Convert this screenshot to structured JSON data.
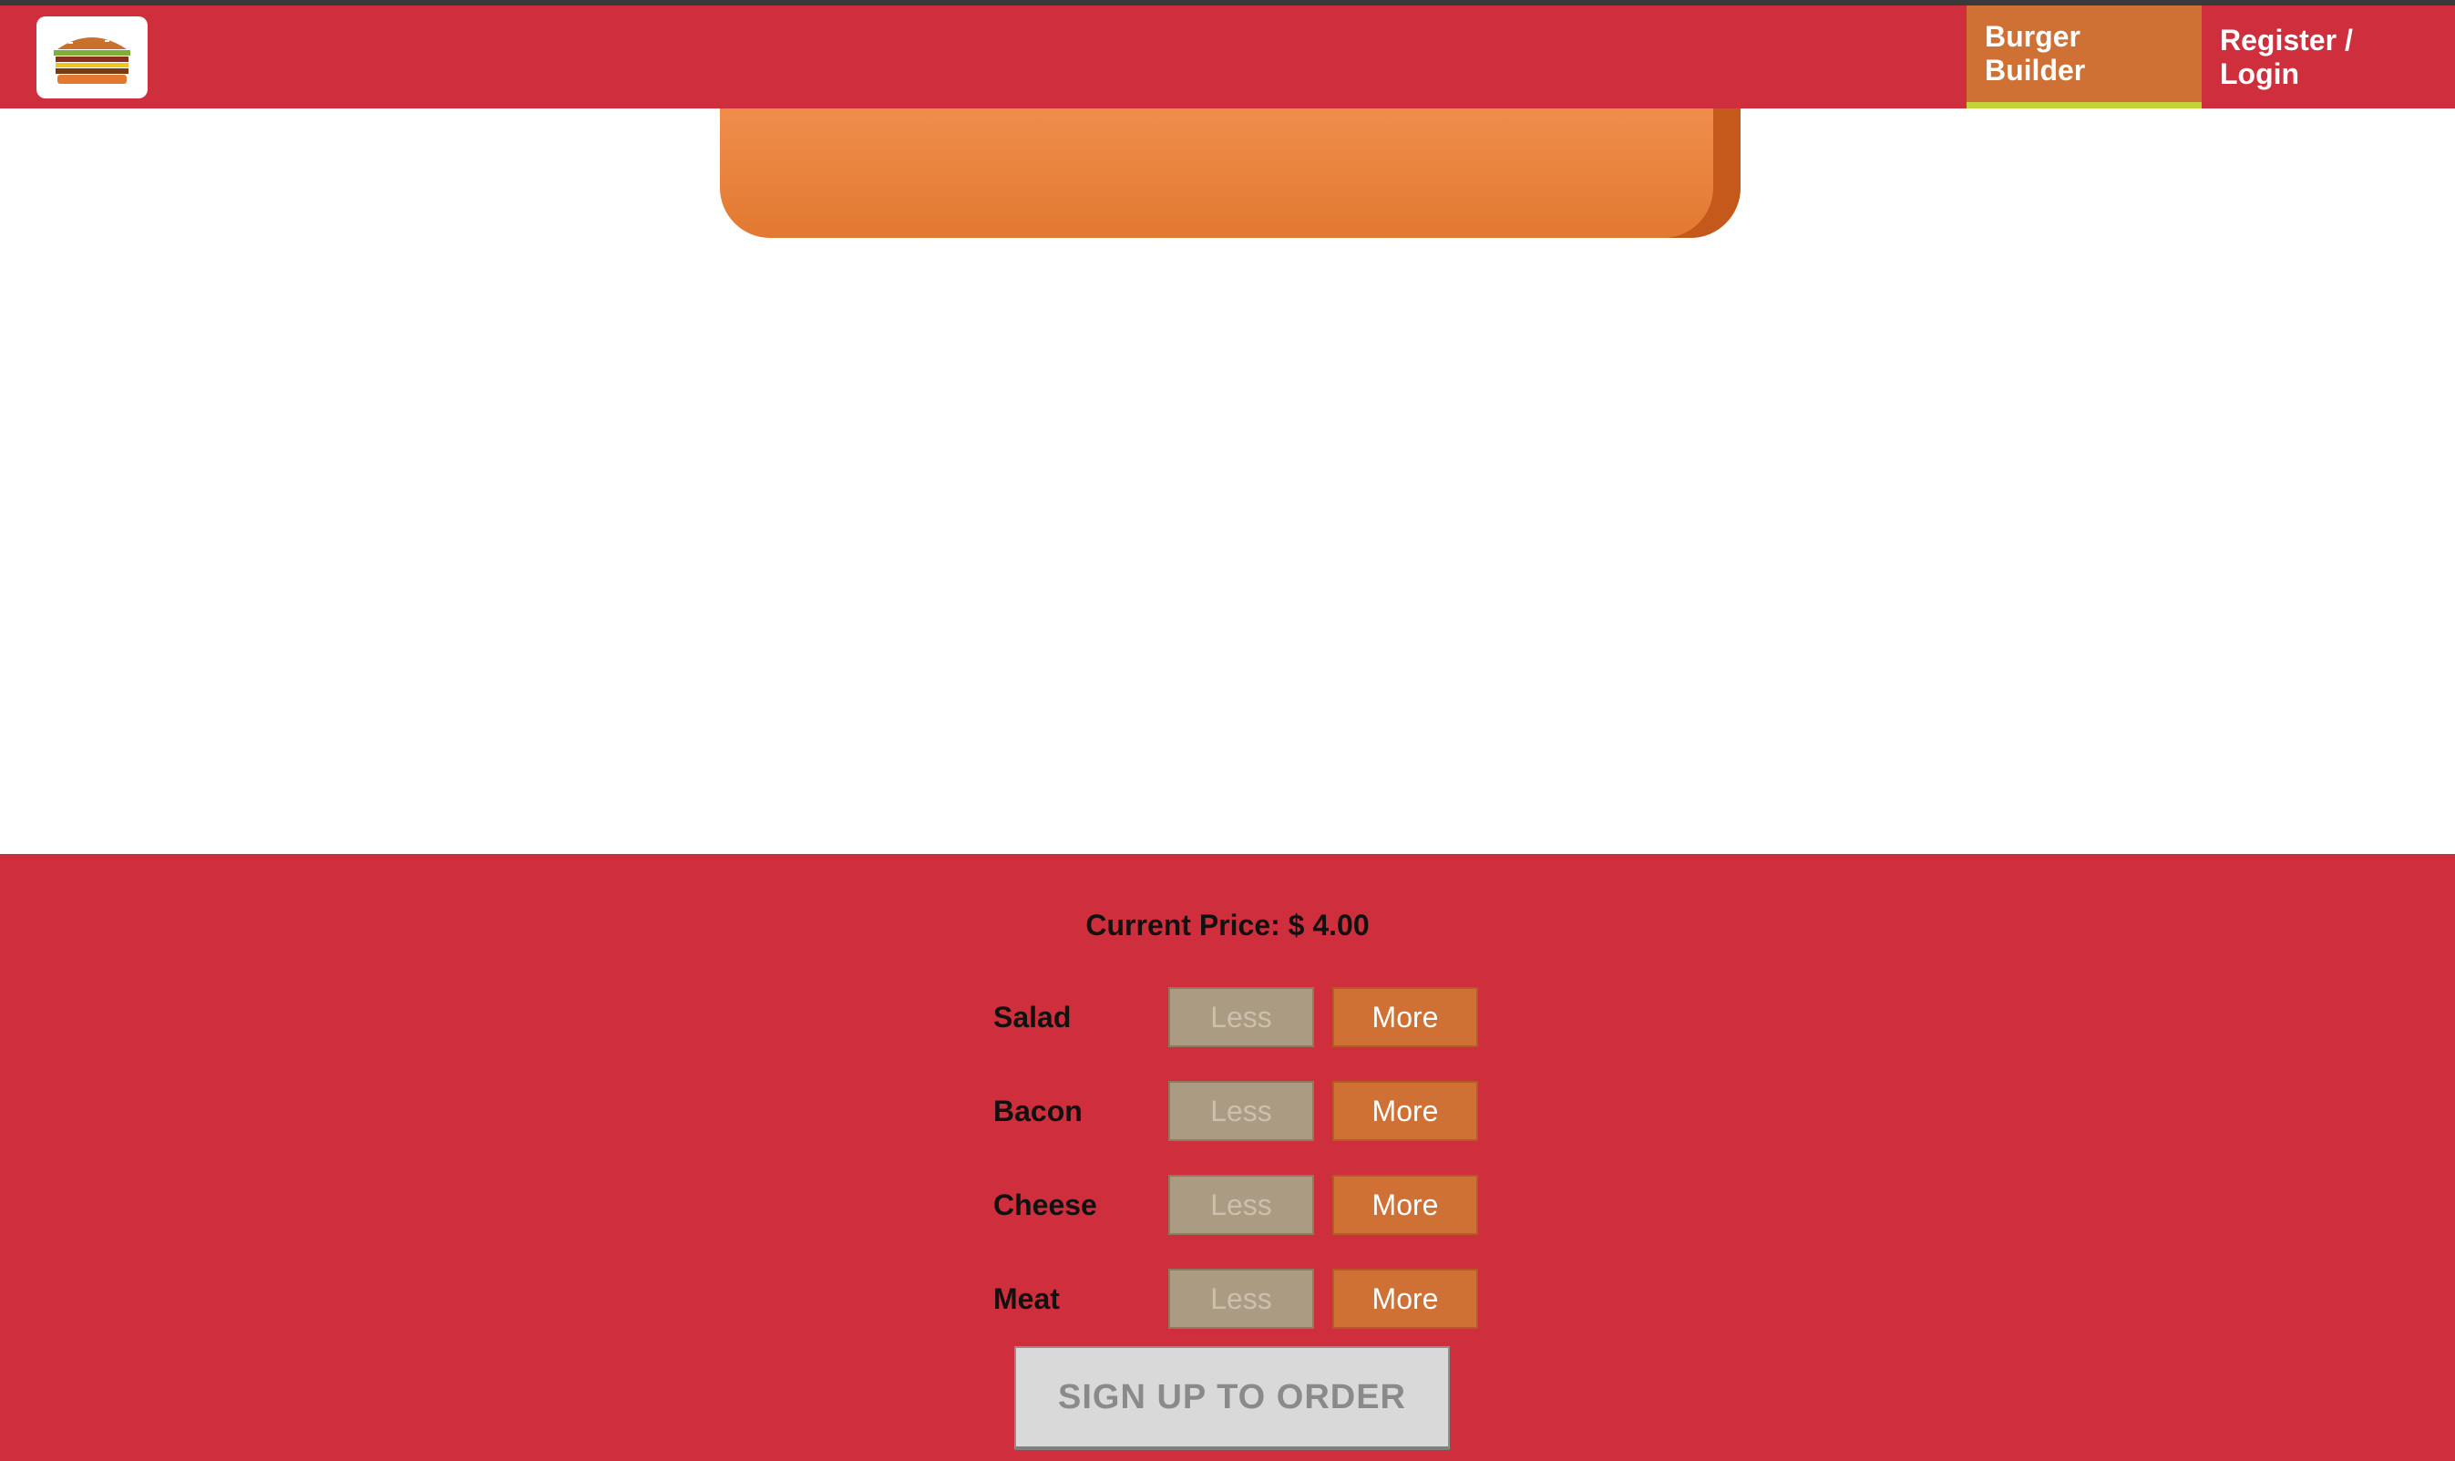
{
  "header": {
    "logo_icon": "burger-logo-icon",
    "nav": [
      {
        "label": "Burger Builder",
        "active": true
      },
      {
        "label": "Register / Login",
        "active": false
      }
    ]
  },
  "build_controls": {
    "price_label": "Current Price:",
    "price_value": "$ 4.00",
    "ingredients": [
      {
        "label": "Salad",
        "less": "Less",
        "more": "More"
      },
      {
        "label": "Bacon",
        "less": "Less",
        "more": "More"
      },
      {
        "label": "Cheese",
        "less": "Less",
        "more": "More"
      },
      {
        "label": "Meat",
        "less": "Less",
        "more": "More"
      }
    ],
    "order_button": "SIGN UP TO ORDER"
  },
  "colors": {
    "toolbar": "#cf2f3c",
    "active_nav": "#cf7034",
    "active_underline": "#c5d33b",
    "more_button": "#cf7034",
    "less_button": "#ab9b83"
  }
}
